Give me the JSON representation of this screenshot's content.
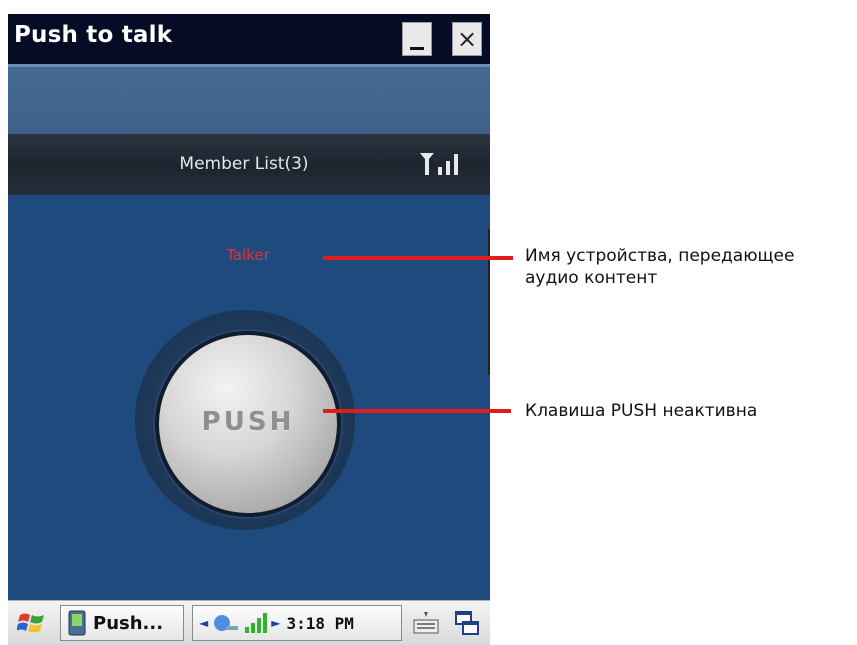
{
  "window": {
    "title": "Push to talk",
    "minimize_icon": "minimize-icon",
    "close_label": "×"
  },
  "member_bar": {
    "label": "Member List(3)",
    "signal_icon": "signal-strength-icon"
  },
  "speaker": {
    "name": "Talker"
  },
  "push_button": {
    "label": "PUSH",
    "state": "inactive"
  },
  "taskbar": {
    "start_icon": "windows-flag-icon",
    "task_label": "Push...",
    "task_icon": "app-icon",
    "tray_icons": [
      "network-icon",
      "signal-bars-icon"
    ],
    "clock": "3:18 PM",
    "keyboard_icon": "keyboard-icon",
    "multitask_icon": "window-switch-icon"
  },
  "annotations": {
    "speaker_note_line1": "Имя устройства, передающее",
    "speaker_note_line2": "аудио контент",
    "push_note": "Клавиша PUSH неактивна"
  },
  "colors": {
    "background": "#1f4a7d",
    "titlebar": "#060b26",
    "speaker_text": "#d8363f",
    "callout": "#e11c1c"
  }
}
